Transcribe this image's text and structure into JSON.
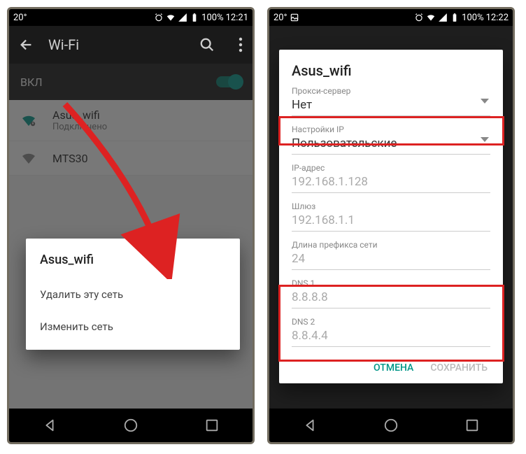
{
  "screen1": {
    "status": {
      "temp": "20°",
      "battery": "100%",
      "time": "12:21"
    },
    "toolbar_title": "Wi-Fi",
    "toggle_label": "ВКЛ",
    "networks": [
      {
        "ssid": "Asus_wifi",
        "status": "Подключено"
      },
      {
        "ssid": "MTS30",
        "status": ""
      }
    ],
    "dialog": {
      "title": "Asus_wifi",
      "item_forget": "Удалить эту сеть",
      "item_modify": "Изменить сеть"
    }
  },
  "screen2": {
    "status": {
      "temp": "20°",
      "battery": "100%",
      "time": "12:22"
    },
    "dialog": {
      "title": "Asus_wifi",
      "proxy_label": "Прокси-сервер",
      "proxy_value": "Нет",
      "ip_settings_label": "Настройки IP",
      "ip_settings_value": "Пользовательские",
      "ip_addr_label": "IP-адрес",
      "ip_addr_value": "192.168.1.128",
      "gateway_label": "Шлюз",
      "gateway_value": "192.168.1.1",
      "prefix_label": "Длина префикса сети",
      "prefix_value": "24",
      "dns1_label": "DNS 1",
      "dns1_value": "8.8.8.8",
      "dns2_label": "DNS 2",
      "dns2_value": "8.8.4.4",
      "cancel": "ОТМЕНА",
      "save": "СОХРАНИТЬ"
    }
  }
}
